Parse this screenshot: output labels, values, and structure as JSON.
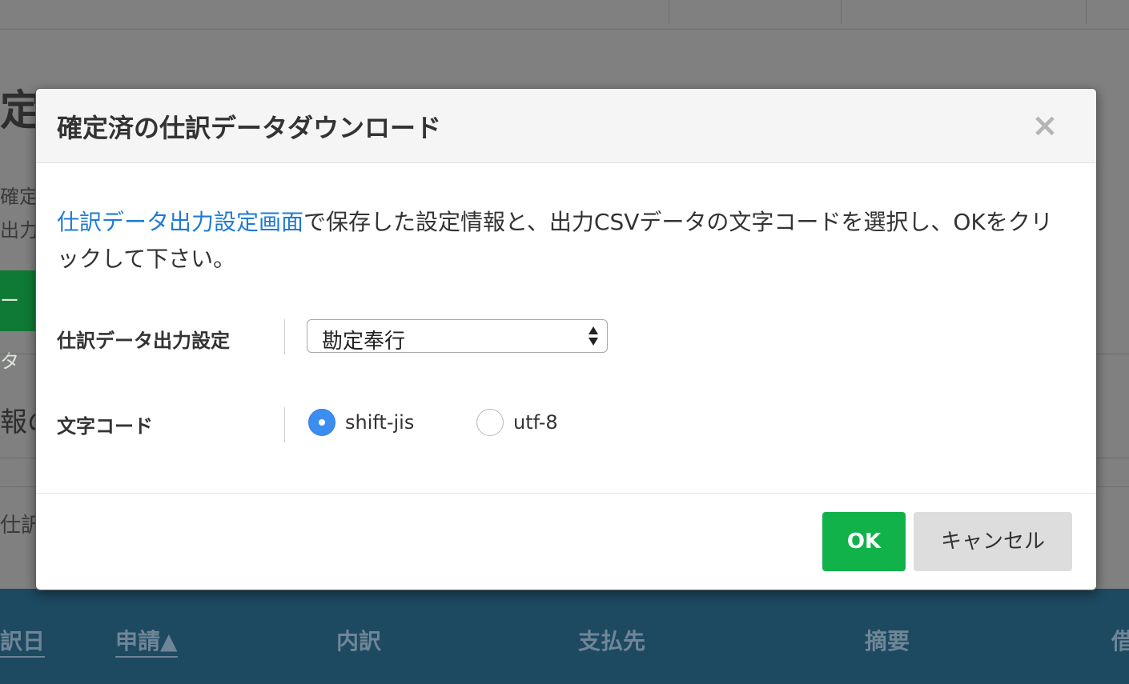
{
  "background": {
    "heading": "定　出力完了",
    "text1": "確定",
    "text2": "出力",
    "green_button": "ータ",
    "section": "報の",
    "row_text": "仕訳",
    "table_headers": [
      "訳日",
      "申請▲",
      "内訳",
      "支払先",
      "摘要",
      "借"
    ]
  },
  "modal": {
    "title": "確定済の仕訳データダウンロード",
    "close_glyph": "×",
    "description_link": "仕訳データ出力設定画面",
    "description_rest": "で保存した設定情報と、出力CSVデータの文字コードを選択し、OKをクリックして下さい。",
    "setting_label": "仕訳データ出力設定",
    "setting_value": "勘定奉行",
    "encoding_label": "文字コード",
    "encoding_options": [
      {
        "label": "shift-jis",
        "selected": true
      },
      {
        "label": "utf-8",
        "selected": false
      }
    ],
    "ok_label": "OK",
    "cancel_label": "キャンセル"
  },
  "colors": {
    "accent_link": "#1f7ad6",
    "ok_button": "#12b24b",
    "radio_selected": "#3b8ef0",
    "table_header_bg": "#1d4961"
  }
}
